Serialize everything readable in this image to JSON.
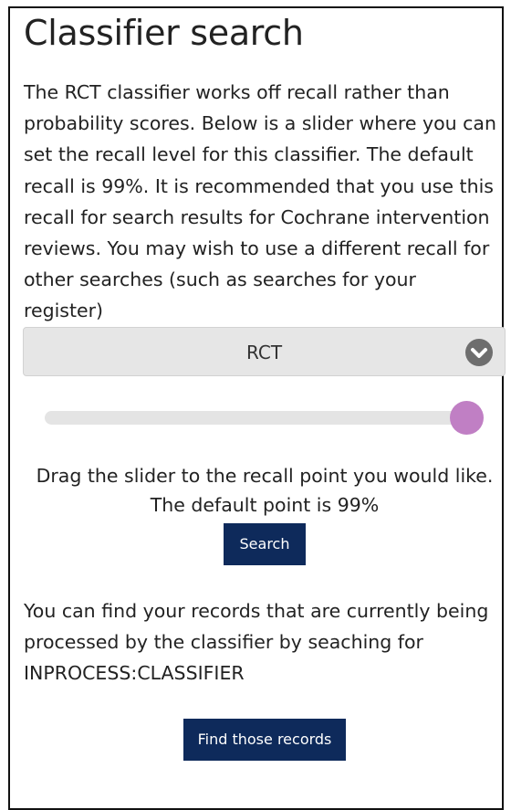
{
  "page": {
    "title": "Classifier search",
    "intro": "The RCT classifier works off recall rather than probability scores. Below is a slider where you can set the recall level for this classifier. The default recall is 99%. It is recommended that you use this recall for search results for Cochrane intervention reviews. You may wish to use a different recall for other searches (such as searches for your register)"
  },
  "classifier_select": {
    "selected": "RCT",
    "icon": "chevron-down-circle-icon",
    "chevron_color": "#6e6e6e"
  },
  "slider": {
    "value_fraction": 0.97,
    "thumb_color": "#c07fc4",
    "track_color": "#e4e4e4",
    "help_line1": "Drag the slider to the recall point you would like.",
    "help_line2": "The default point is 99%"
  },
  "search_button": {
    "label": "Search"
  },
  "records": {
    "text": "You can find your records that are currently being processed by the classifier by seaching for INPROCESS:CLASSIFIER",
    "button_label": "Find those records"
  },
  "colors": {
    "button_bg": "#0e2a5b",
    "button_text": "#ffffff"
  }
}
